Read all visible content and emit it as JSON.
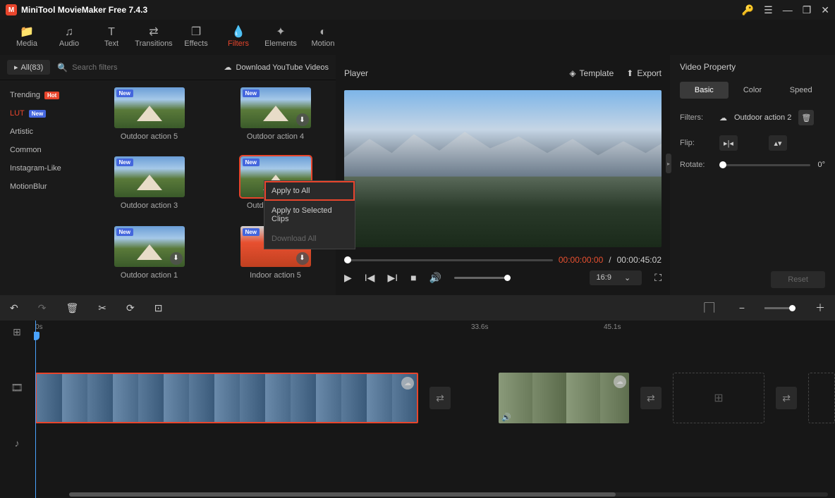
{
  "app": {
    "title": "MiniTool MovieMaker Free 7.4.3"
  },
  "toolbar": [
    {
      "label": "Media",
      "icon": "📁"
    },
    {
      "label": "Audio",
      "icon": "♫"
    },
    {
      "label": "Text",
      "icon": "T"
    },
    {
      "label": "Transitions",
      "icon": "⇄"
    },
    {
      "label": "Effects",
      "icon": "❐"
    },
    {
      "label": "Filters",
      "icon": "💧",
      "active": true
    },
    {
      "label": "Elements",
      "icon": "✦"
    },
    {
      "label": "Motion",
      "icon": "◐"
    }
  ],
  "filters": {
    "all_label": "All(83)",
    "search_placeholder": "Search filters",
    "download_label": "Download YouTube Videos",
    "categories": [
      {
        "label": "Trending",
        "badge": "Hot",
        "badge_cls": "badge-hot"
      },
      {
        "label": "LUT",
        "badge": "New",
        "badge_cls": "badge-new",
        "active": true
      },
      {
        "label": "Artistic"
      },
      {
        "label": "Common"
      },
      {
        "label": "Instagram-Like"
      },
      {
        "label": "MotionBlur"
      }
    ],
    "items": [
      {
        "label": "Outdoor action 5"
      },
      {
        "label": "Outdoor action 4",
        "dl": true
      },
      {
        "label": "Outdoor action 3"
      },
      {
        "label": "Outdoor action 2",
        "selected": true
      },
      {
        "label": "Outdoor action 1",
        "dl": true
      },
      {
        "label": "Indoor action 5",
        "dl": true,
        "indoor": true
      }
    ]
  },
  "context_menu": [
    {
      "label": "Apply to All",
      "hl": true
    },
    {
      "label": "Apply to Selected Clips"
    },
    {
      "label": "Download All",
      "dis": true
    }
  ],
  "player": {
    "title": "Player",
    "template": "Template",
    "export": "Export",
    "time_current": "00:00:00:00",
    "time_total": "00:00:45:02",
    "aspect": "16:9"
  },
  "props": {
    "title": "Video Property",
    "tabs": [
      "Basic",
      "Color",
      "Speed"
    ],
    "filters_label": "Filters:",
    "filter_value": "Outdoor action 2",
    "flip_label": "Flip:",
    "rotate_label": "Rotate:",
    "rotate_value": "0°",
    "reset": "Reset"
  },
  "timeline": {
    "ruler": [
      "0s",
      "33.6s",
      "45.1s"
    ]
  }
}
